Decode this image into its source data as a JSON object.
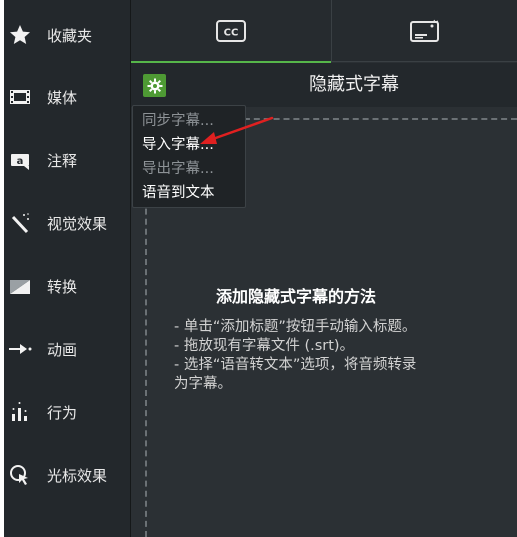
{
  "sidebar": {
    "items": [
      {
        "label": "收藏夹",
        "icon": "star-icon"
      },
      {
        "label": "媒体",
        "icon": "film-icon"
      },
      {
        "label": "注释",
        "icon": "annotation-icon"
      },
      {
        "label": "视觉效果",
        "icon": "magic-wand-icon"
      },
      {
        "label": "转换",
        "icon": "transition-icon"
      },
      {
        "label": "动画",
        "icon": "animation-arrow-icon"
      },
      {
        "label": "行为",
        "icon": "behavior-icon"
      },
      {
        "label": "光标效果",
        "icon": "cursor-effect-icon"
      }
    ]
  },
  "tabs": {
    "cc_label": "CC",
    "other_icon": "media-card-icon"
  },
  "header": {
    "title": "隐藏式字幕",
    "gear_icon": "gear-icon"
  },
  "menu": {
    "items": [
      {
        "label": "同步字幕...",
        "enabled": false
      },
      {
        "label": "导入字幕...",
        "enabled": true
      },
      {
        "label": "导出字幕...",
        "enabled": false
      },
      {
        "label": "语音到文本",
        "enabled": true
      }
    ]
  },
  "dropzone": {
    "title": "添加隐藏式字幕的方法",
    "lines": [
      "- 单击“添加标题”按钮手动输入标题。",
      "- 拖放现有字幕文件 (.srt)。",
      "- 选择“语音转文本”选项，将音频转录",
      "为字幕。"
    ]
  },
  "colors": {
    "accent": "#56b64a",
    "gear_bg": "#4e9a34",
    "annotation_arrow": "#e02020"
  }
}
